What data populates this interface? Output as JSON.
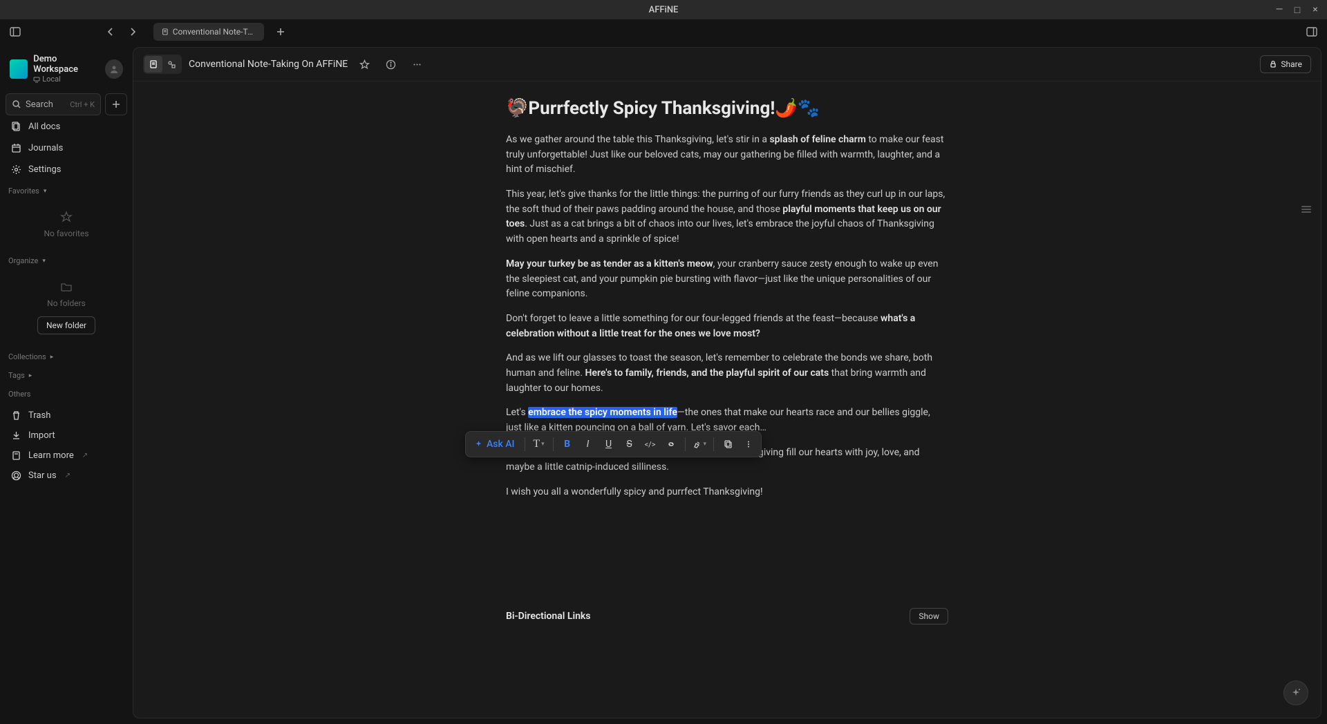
{
  "app": {
    "title": "AFFiNE"
  },
  "window": {
    "min": "—",
    "max": "□",
    "close": "×"
  },
  "tab": {
    "label": "Conventional Note-Taking O"
  },
  "workspace": {
    "name": "Demo Workspace",
    "sub": "Local"
  },
  "search": {
    "label": "Search",
    "kbd": "Ctrl + K"
  },
  "nav": {
    "all_docs": "All docs",
    "journals": "Journals",
    "settings": "Settings"
  },
  "sections": {
    "favorites": "Favorites",
    "organize": "Organize",
    "collections": "Collections",
    "tags": "Tags",
    "others": "Others"
  },
  "empty": {
    "favorites": "No favorites",
    "folders": "No folders",
    "new_folder": "New folder"
  },
  "bottom": {
    "trash": "Trash",
    "import": "Import",
    "learn": "Learn more",
    "star": "Star us"
  },
  "header": {
    "doc_title": "Conventional Note-Taking On AFFiNE",
    "share": "Share"
  },
  "doc": {
    "title": "🦃Purrfectly Spicy Thanksgiving!🌶️🐾",
    "p1a": "As we gather around the table this Thanksgiving, let's stir in a ",
    "p1b": "splash of feline charm",
    "p1c": " to make our feast truly unforgettable! Just like our beloved cats, may our gathering be filled with warmth, laughter, and a hint of mischief.",
    "p2a": "This year, let's give thanks for the little things: the purring of our furry friends as they curl up in our laps, the soft thud of their paws padding around the house, and those ",
    "p2b": "playful moments that keep us on our toes",
    "p2c": ". Just as a cat brings a bit of chaos into our lives, let's embrace the joyful chaos of Thanksgiving with open hearts and a sprinkle of spice!",
    "p3a": "May your turkey be as tender as a kitten's meow",
    "p3b": ", your cranberry sauce zesty enough to wake up even the sleepiest cat, and your pumpkin pie bursting with flavor—just like the unique personalities of our feline companions.",
    "p4a": "Don't forget to leave a little something for our four-legged friends at the feast—because ",
    "p4b": "what's a celebration without a little treat for the ones we love most?",
    "p5a": "And as we lift our glasses to toast the season, let's remember to celebrate the bonds we share, both human and feline. ",
    "p5b": "Here's to family, friends, and the playful spirit of our cats",
    "p5c": " that bring warmth and laughter to our homes.",
    "p6a": " Let's ",
    "p6sel": "embrace the spicy moments in life",
    "p6b": "—the ones that make our hearts race and our bellies giggle, just like a kitten pouncing on a ball of yarn. Let's savor each…",
    "p7": "So gather around, share stories, and let the spirit of Thanksgiving fill our hearts with joy, love, and maybe a little catnip-induced silliness.",
    "p8": "I wish you all a wonderfully spicy and purrfect Thanksgiving!"
  },
  "toolbar": {
    "ask_ai": "Ask AI",
    "text": "T",
    "bold": "B",
    "italic": "I",
    "underline": "U",
    "strike": "S",
    "code": "</>",
    "link": "🔗"
  },
  "bidi": {
    "title": "Bi-Directional Links",
    "show": "Show"
  }
}
